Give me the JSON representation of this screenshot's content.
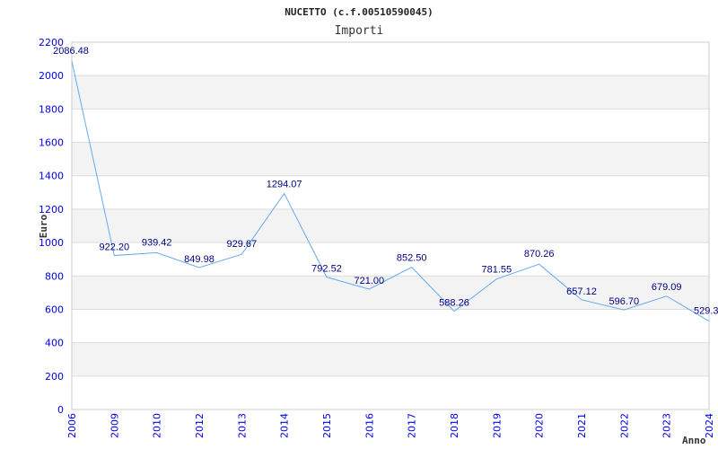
{
  "chart_data": {
    "type": "line",
    "title": "NUCETTO (c.f.00510590045)",
    "subtitle": "Importi",
    "xlabel": "Anno",
    "ylabel": "Euro",
    "ylim": [
      0,
      2200
    ],
    "yticks": [
      0,
      200,
      400,
      600,
      800,
      1000,
      1200,
      1400,
      1600,
      1800,
      2000,
      2200
    ],
    "grid": true,
    "categories": [
      "2006",
      "2009",
      "2010",
      "2012",
      "2013",
      "2014",
      "2015",
      "2016",
      "2017",
      "2018",
      "2019",
      "2020",
      "2021",
      "2022",
      "2023",
      "2024"
    ],
    "values": [
      2086.48,
      922.2,
      939.42,
      849.98,
      929.67,
      1294.07,
      792.52,
      721.0,
      852.5,
      588.26,
      781.55,
      870.26,
      657.12,
      596.7,
      679.09,
      529.3
    ],
    "data_labels": [
      "2086.48",
      "922.20",
      "939.42",
      "849.98",
      "929.67",
      "1294.07",
      "792.52",
      "721.00",
      "852.50",
      "588.26",
      "781.55",
      "870.26",
      "657.12",
      "596.70",
      "679.09",
      "529.3"
    ],
    "colors": {
      "line": "#66aaee",
      "band": "#f3f3f3",
      "tick": "#0000ee",
      "label": "#000080"
    }
  }
}
